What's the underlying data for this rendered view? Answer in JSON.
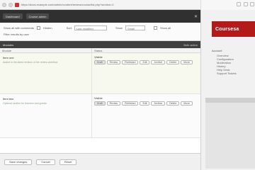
{
  "browser": {
    "url": "https://docs.example.com/admin/content/review/course/list.php?section=1"
  },
  "app": {
    "btn1": "Dashboard",
    "btn2": "Course admin"
  },
  "filters": {
    "row1_label": "Show all with comments",
    "row1_check": "Hidden",
    "field1_label": "Sort",
    "field1_value": "Last modified",
    "field2_label": "Show",
    "field2_value": "Small",
    "checkbox2": "Show all",
    "row2_label": "Filter results by user"
  },
  "panel": {
    "header_left": "Modules",
    "header_right": "Bulk action",
    "col1": "Module",
    "col2": "Status"
  },
  "entries": [
    {
      "title": "Item one",
      "desc": "Added in the latest revision of the review workflow",
      "status": "Visible",
      "tags": [
        "Draft",
        "Review",
        "Published",
        "Edit",
        "Archive",
        "Delete",
        "Move"
      ]
    },
    {
      "title": "Item two",
      "desc": "Optional section for learners and guests",
      "status": "Visible",
      "tags": [
        "Draft",
        "Review",
        "Published",
        "Edit",
        "Archive",
        "Delete",
        "Move"
      ]
    }
  ],
  "bottom": {
    "b1": "Save changes",
    "b2": "Cancel",
    "b3": "Reset"
  },
  "sidebar": {
    "brand": "Coursesa",
    "menu_head": "Account",
    "items": [
      "Overview",
      "Configuration",
      "Moderation",
      "History",
      "Help Desk",
      "Support Tickets"
    ]
  }
}
